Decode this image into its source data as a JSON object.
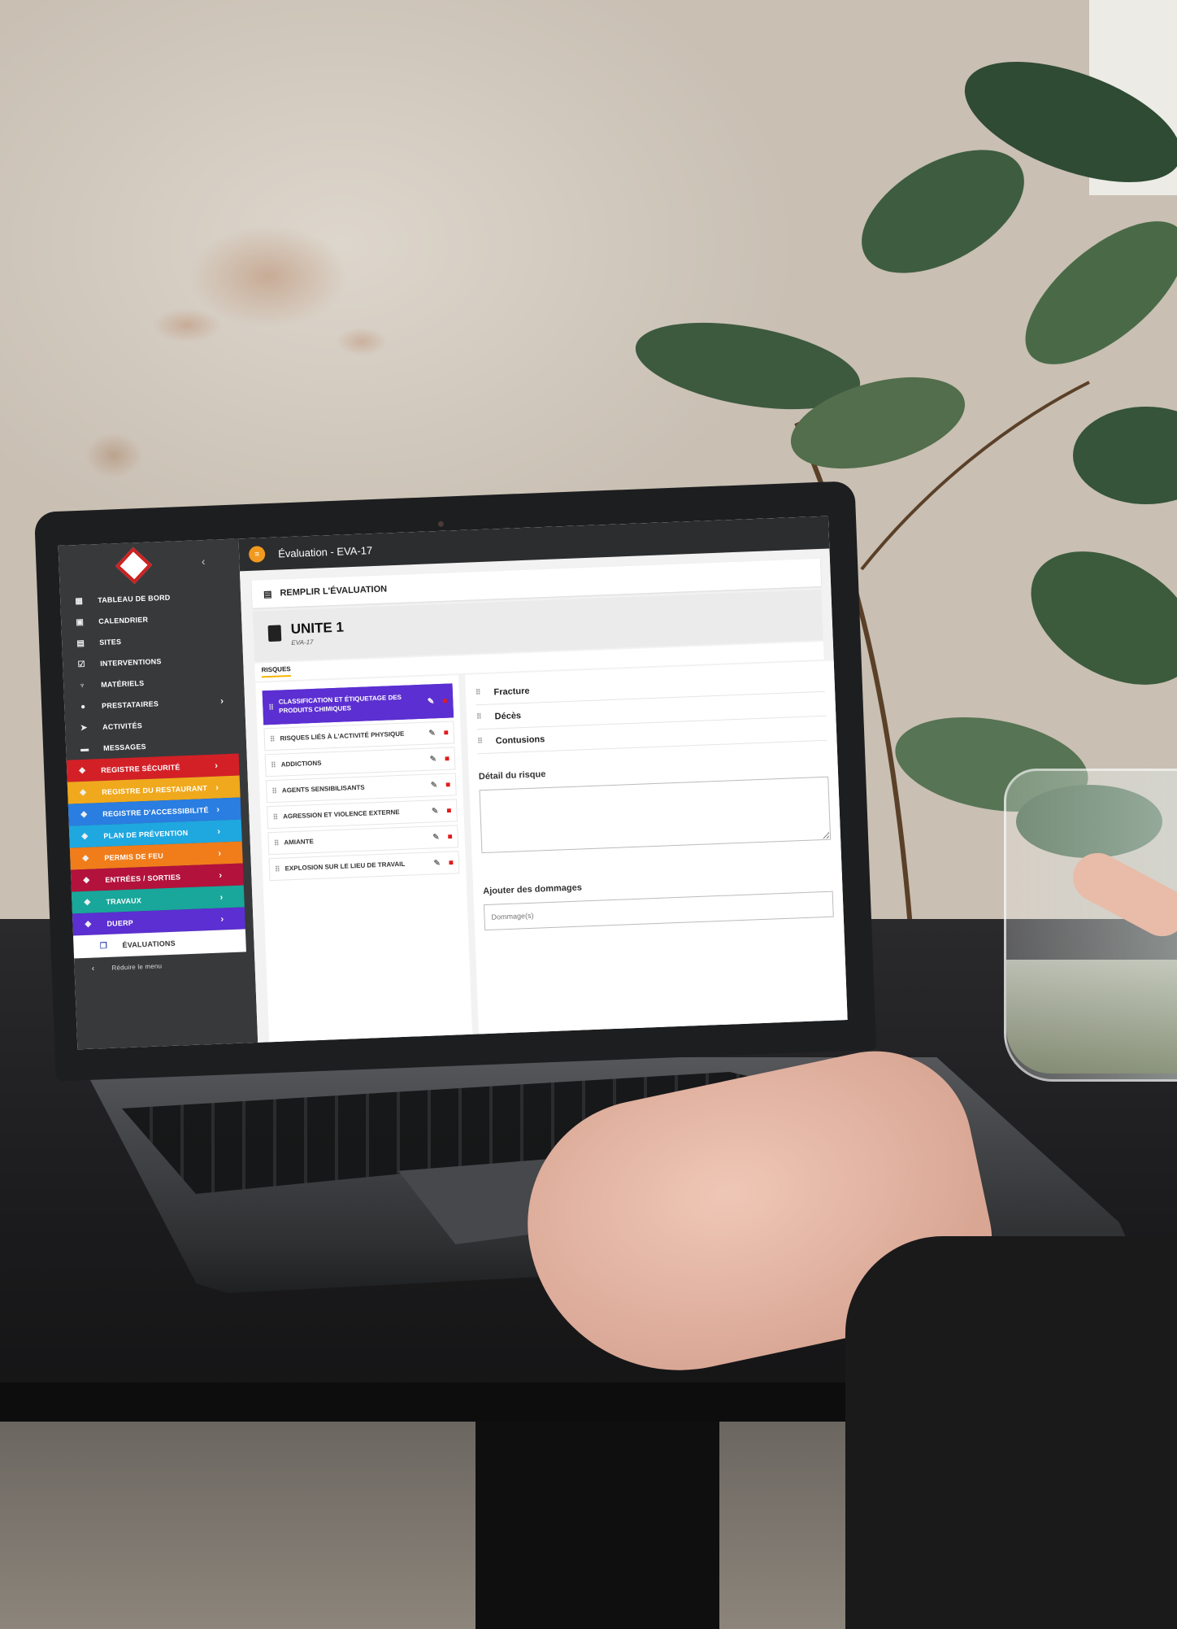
{
  "colors": {
    "sidebar_bg": "#38393b",
    "topbar_bg": "#2c2d2f",
    "accent_orange": "#f29a1f",
    "active_item": "#5b2fd1",
    "delete_red": "#e01b1b"
  },
  "sidebar": {
    "collapse_icon": "chevron-left-icon",
    "items": [
      {
        "label": "TABLEAU DE BORD",
        "icon": "dashboard-icon"
      },
      {
        "label": "CALENDRIER",
        "icon": "calendar-icon"
      },
      {
        "label": "SITES",
        "icon": "building-icon"
      },
      {
        "label": "INTERVENTIONS",
        "icon": "checkbox-icon"
      },
      {
        "label": "MATÉRIELS",
        "icon": "tool-icon"
      },
      {
        "label": "PRESTATAIRES",
        "icon": "user-icon"
      },
      {
        "label": "ACTIVITÉS",
        "icon": "activity-icon"
      },
      {
        "label": "MESSAGES",
        "icon": "message-icon"
      }
    ],
    "registers": [
      {
        "label": "REGISTRE SÉCURITÉ",
        "color": "#d32027"
      },
      {
        "label": "REGISTRE DU RESTAURANT",
        "color": "#f0a91c"
      },
      {
        "label": "REGISTRE D'ACCESSIBILITÉ",
        "color": "#2a7de1"
      },
      {
        "label": "PLAN DE PRÉVENTION",
        "color": "#1fa7e0"
      },
      {
        "label": "PERMIS DE FEU",
        "color": "#f07d1a"
      },
      {
        "label": "ENTRÉES / SORTIES",
        "color": "#b3123c"
      },
      {
        "label": "TRAVAUX",
        "color": "#18a79a"
      },
      {
        "label": "DUERP",
        "color": "#5b2fd1"
      }
    ],
    "sub_item": "ÉVALUATIONS",
    "collapse_label": "Réduire le menu"
  },
  "topbar": {
    "title": "Évaluation - EVA-17"
  },
  "card": {
    "header": "REMPLIR L'ÉVALUATION",
    "unit_title": "UNITE 1",
    "unit_code": "EVA-17",
    "tab": "RISQUES"
  },
  "risks": [
    "CLASSIFICATION ET ÉTIQUETAGE DES PRODUITS CHIMIQUES",
    "RISQUES LIÉS À L'ACTIVITÉ PHYSIQUE",
    "ADDICTIONS",
    "AGENTS SENSIBILISANTS",
    "AGRESSION ET VIOLENCE EXTERNE",
    "AMIANTE",
    "EXPLOSION SUR LE LIEU DE TRAVAIL"
  ],
  "damages": [
    "Fracture",
    "Décès",
    "Contusions"
  ],
  "detail": {
    "label": "Détail du risque",
    "add_label": "Ajouter des dommages",
    "add_placeholder": "Dommage(s)"
  }
}
